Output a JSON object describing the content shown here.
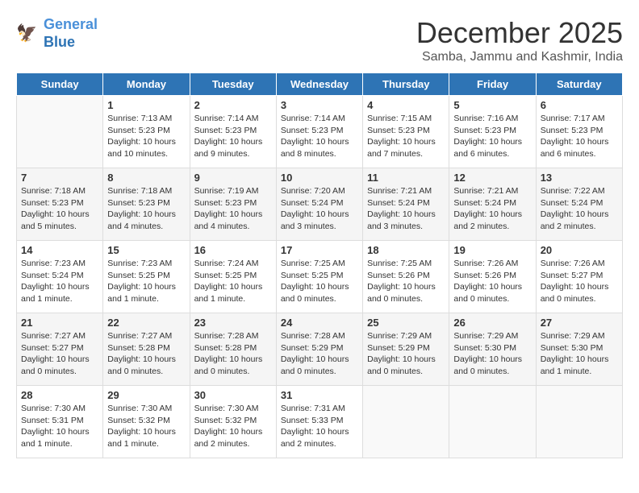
{
  "header": {
    "logo_line1": "General",
    "logo_line2": "Blue",
    "title": "December 2025",
    "subtitle": "Samba, Jammu and Kashmir, India"
  },
  "weekdays": [
    "Sunday",
    "Monday",
    "Tuesday",
    "Wednesday",
    "Thursday",
    "Friday",
    "Saturday"
  ],
  "weeks": [
    [
      {
        "num": "",
        "empty": true
      },
      {
        "num": "1",
        "sunrise": "7:13 AM",
        "sunset": "5:23 PM",
        "daylight": "10 hours and 10 minutes."
      },
      {
        "num": "2",
        "sunrise": "7:14 AM",
        "sunset": "5:23 PM",
        "daylight": "10 hours and 9 minutes."
      },
      {
        "num": "3",
        "sunrise": "7:14 AM",
        "sunset": "5:23 PM",
        "daylight": "10 hours and 8 minutes."
      },
      {
        "num": "4",
        "sunrise": "7:15 AM",
        "sunset": "5:23 PM",
        "daylight": "10 hours and 7 minutes."
      },
      {
        "num": "5",
        "sunrise": "7:16 AM",
        "sunset": "5:23 PM",
        "daylight": "10 hours and 6 minutes."
      },
      {
        "num": "6",
        "sunrise": "7:17 AM",
        "sunset": "5:23 PM",
        "daylight": "10 hours and 6 minutes."
      }
    ],
    [
      {
        "num": "7",
        "sunrise": "7:18 AM",
        "sunset": "5:23 PM",
        "daylight": "10 hours and 5 minutes."
      },
      {
        "num": "8",
        "sunrise": "7:18 AM",
        "sunset": "5:23 PM",
        "daylight": "10 hours and 4 minutes."
      },
      {
        "num": "9",
        "sunrise": "7:19 AM",
        "sunset": "5:23 PM",
        "daylight": "10 hours and 4 minutes."
      },
      {
        "num": "10",
        "sunrise": "7:20 AM",
        "sunset": "5:24 PM",
        "daylight": "10 hours and 3 minutes."
      },
      {
        "num": "11",
        "sunrise": "7:21 AM",
        "sunset": "5:24 PM",
        "daylight": "10 hours and 3 minutes."
      },
      {
        "num": "12",
        "sunrise": "7:21 AM",
        "sunset": "5:24 PM",
        "daylight": "10 hours and 2 minutes."
      },
      {
        "num": "13",
        "sunrise": "7:22 AM",
        "sunset": "5:24 PM",
        "daylight": "10 hours and 2 minutes."
      }
    ],
    [
      {
        "num": "14",
        "sunrise": "7:23 AM",
        "sunset": "5:24 PM",
        "daylight": "10 hours and 1 minute."
      },
      {
        "num": "15",
        "sunrise": "7:23 AM",
        "sunset": "5:25 PM",
        "daylight": "10 hours and 1 minute."
      },
      {
        "num": "16",
        "sunrise": "7:24 AM",
        "sunset": "5:25 PM",
        "daylight": "10 hours and 1 minute."
      },
      {
        "num": "17",
        "sunrise": "7:25 AM",
        "sunset": "5:25 PM",
        "daylight": "10 hours and 0 minutes."
      },
      {
        "num": "18",
        "sunrise": "7:25 AM",
        "sunset": "5:26 PM",
        "daylight": "10 hours and 0 minutes."
      },
      {
        "num": "19",
        "sunrise": "7:26 AM",
        "sunset": "5:26 PM",
        "daylight": "10 hours and 0 minutes."
      },
      {
        "num": "20",
        "sunrise": "7:26 AM",
        "sunset": "5:27 PM",
        "daylight": "10 hours and 0 minutes."
      }
    ],
    [
      {
        "num": "21",
        "sunrise": "7:27 AM",
        "sunset": "5:27 PM",
        "daylight": "10 hours and 0 minutes."
      },
      {
        "num": "22",
        "sunrise": "7:27 AM",
        "sunset": "5:28 PM",
        "daylight": "10 hours and 0 minutes."
      },
      {
        "num": "23",
        "sunrise": "7:28 AM",
        "sunset": "5:28 PM",
        "daylight": "10 hours and 0 minutes."
      },
      {
        "num": "24",
        "sunrise": "7:28 AM",
        "sunset": "5:29 PM",
        "daylight": "10 hours and 0 minutes."
      },
      {
        "num": "25",
        "sunrise": "7:29 AM",
        "sunset": "5:29 PM",
        "daylight": "10 hours and 0 minutes."
      },
      {
        "num": "26",
        "sunrise": "7:29 AM",
        "sunset": "5:30 PM",
        "daylight": "10 hours and 0 minutes."
      },
      {
        "num": "27",
        "sunrise": "7:29 AM",
        "sunset": "5:30 PM",
        "daylight": "10 hours and 1 minute."
      }
    ],
    [
      {
        "num": "28",
        "sunrise": "7:30 AM",
        "sunset": "5:31 PM",
        "daylight": "10 hours and 1 minute."
      },
      {
        "num": "29",
        "sunrise": "7:30 AM",
        "sunset": "5:32 PM",
        "daylight": "10 hours and 1 minute."
      },
      {
        "num": "30",
        "sunrise": "7:30 AM",
        "sunset": "5:32 PM",
        "daylight": "10 hours and 2 minutes."
      },
      {
        "num": "31",
        "sunrise": "7:31 AM",
        "sunset": "5:33 PM",
        "daylight": "10 hours and 2 minutes."
      },
      {
        "num": "",
        "empty": true
      },
      {
        "num": "",
        "empty": true
      },
      {
        "num": "",
        "empty": true
      }
    ]
  ]
}
